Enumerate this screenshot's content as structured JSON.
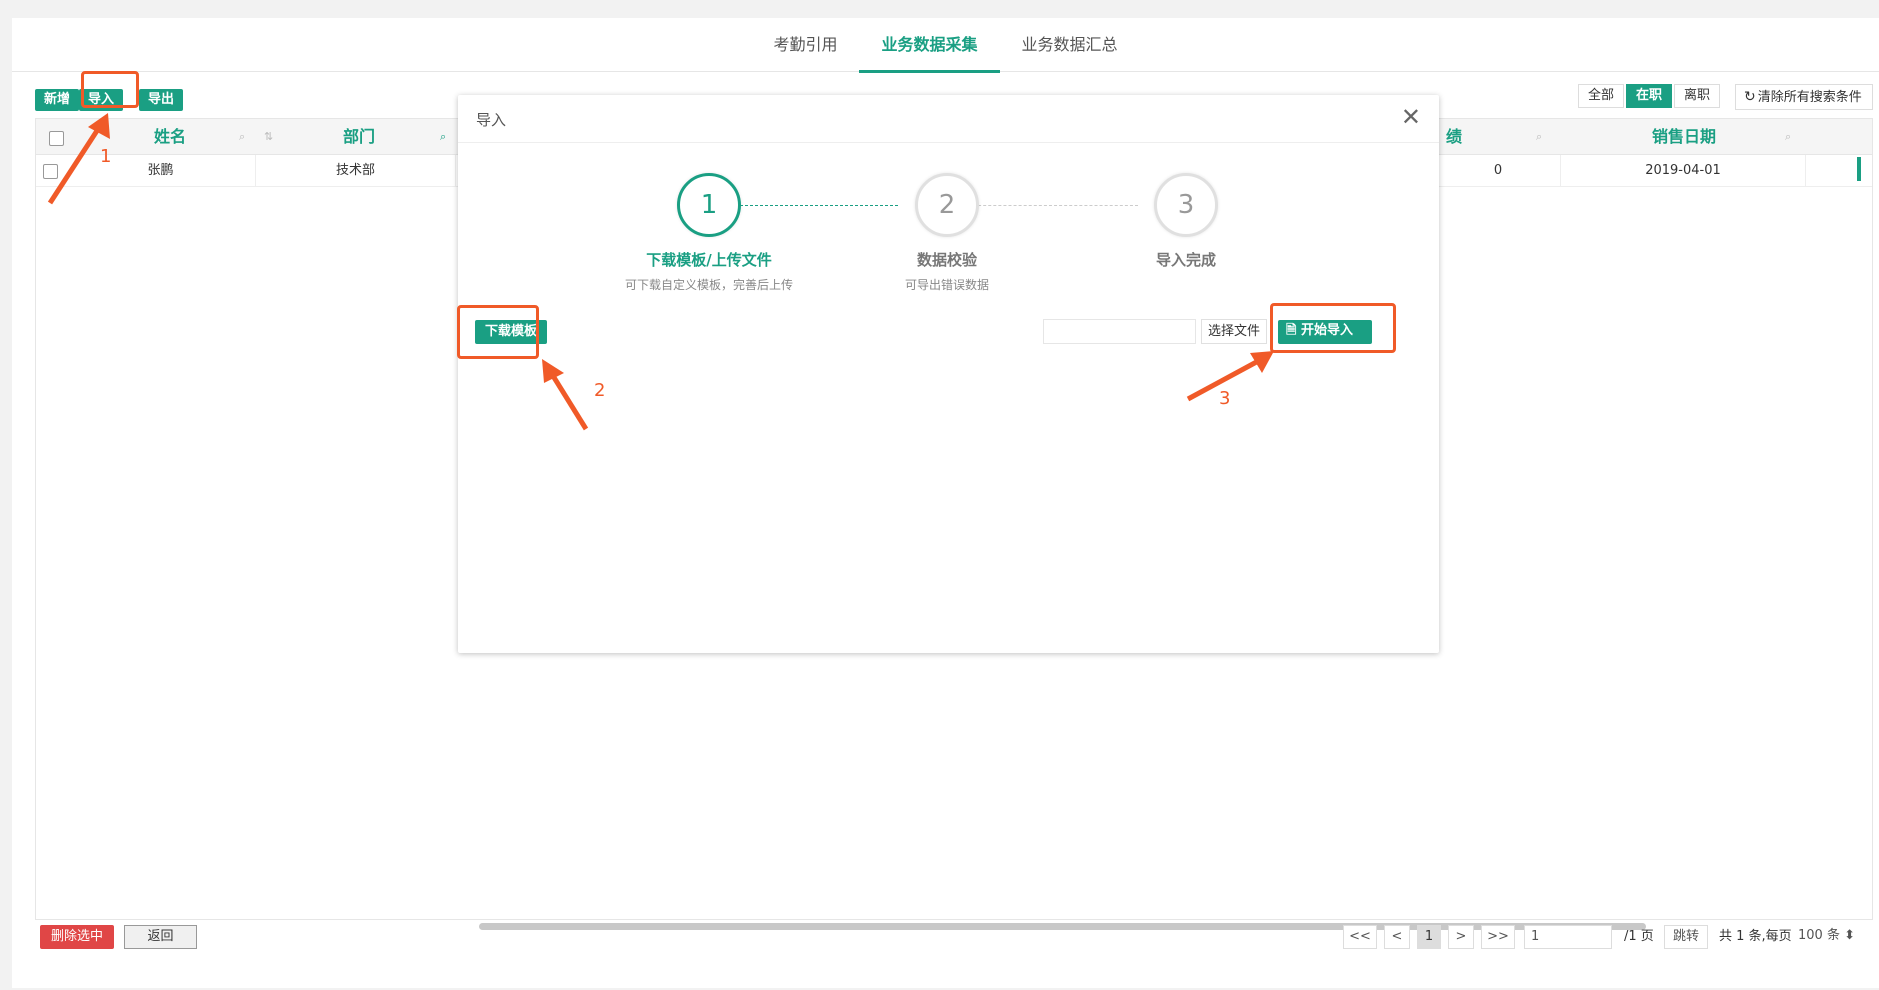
{
  "tabs": [
    "考勤引用",
    "业务数据采集",
    "业务数据汇总"
  ],
  "active_tab": 1,
  "toolbar": {
    "add": "新增",
    "import": "导入",
    "export": "导出"
  },
  "filters": {
    "all": "全部",
    "active": "在职",
    "left": "离职",
    "clear": "清除所有搜索条件"
  },
  "table": {
    "headers": {
      "name": "姓名",
      "dept": "部门",
      "perf_partial": "绩",
      "sales_date": "销售日期"
    },
    "rows": [
      {
        "name": "张鹏",
        "dept": "技术部",
        "perf_partial": "0",
        "sales_date": "2019-04-01"
      }
    ]
  },
  "bottom": {
    "delete": "删除选中",
    "back": "返回",
    "first": "<<",
    "prev": "<",
    "current_page": "1",
    "next": ">",
    "last": ">>",
    "page_input": "1",
    "total_pages": "/1 页",
    "jump": "跳转",
    "summary": "共 1 条,每页",
    "per_page": "100 条"
  },
  "modal": {
    "title": "导入",
    "steps": [
      {
        "num": "1",
        "title": "下载模板/上传文件",
        "desc": "可下载自定义模板，完善后上传"
      },
      {
        "num": "2",
        "title": "数据校验",
        "desc": "可导出错误数据"
      },
      {
        "num": "3",
        "title": "导入完成",
        "desc": ""
      }
    ],
    "download_template": "下载模板",
    "choose_file": "选择文件",
    "start_import": "开始导入"
  },
  "annotations": [
    "1",
    "2",
    "3"
  ],
  "colors": {
    "accent": "#1a9f83",
    "annotation": "#f05a28",
    "danger": "#e04646"
  }
}
